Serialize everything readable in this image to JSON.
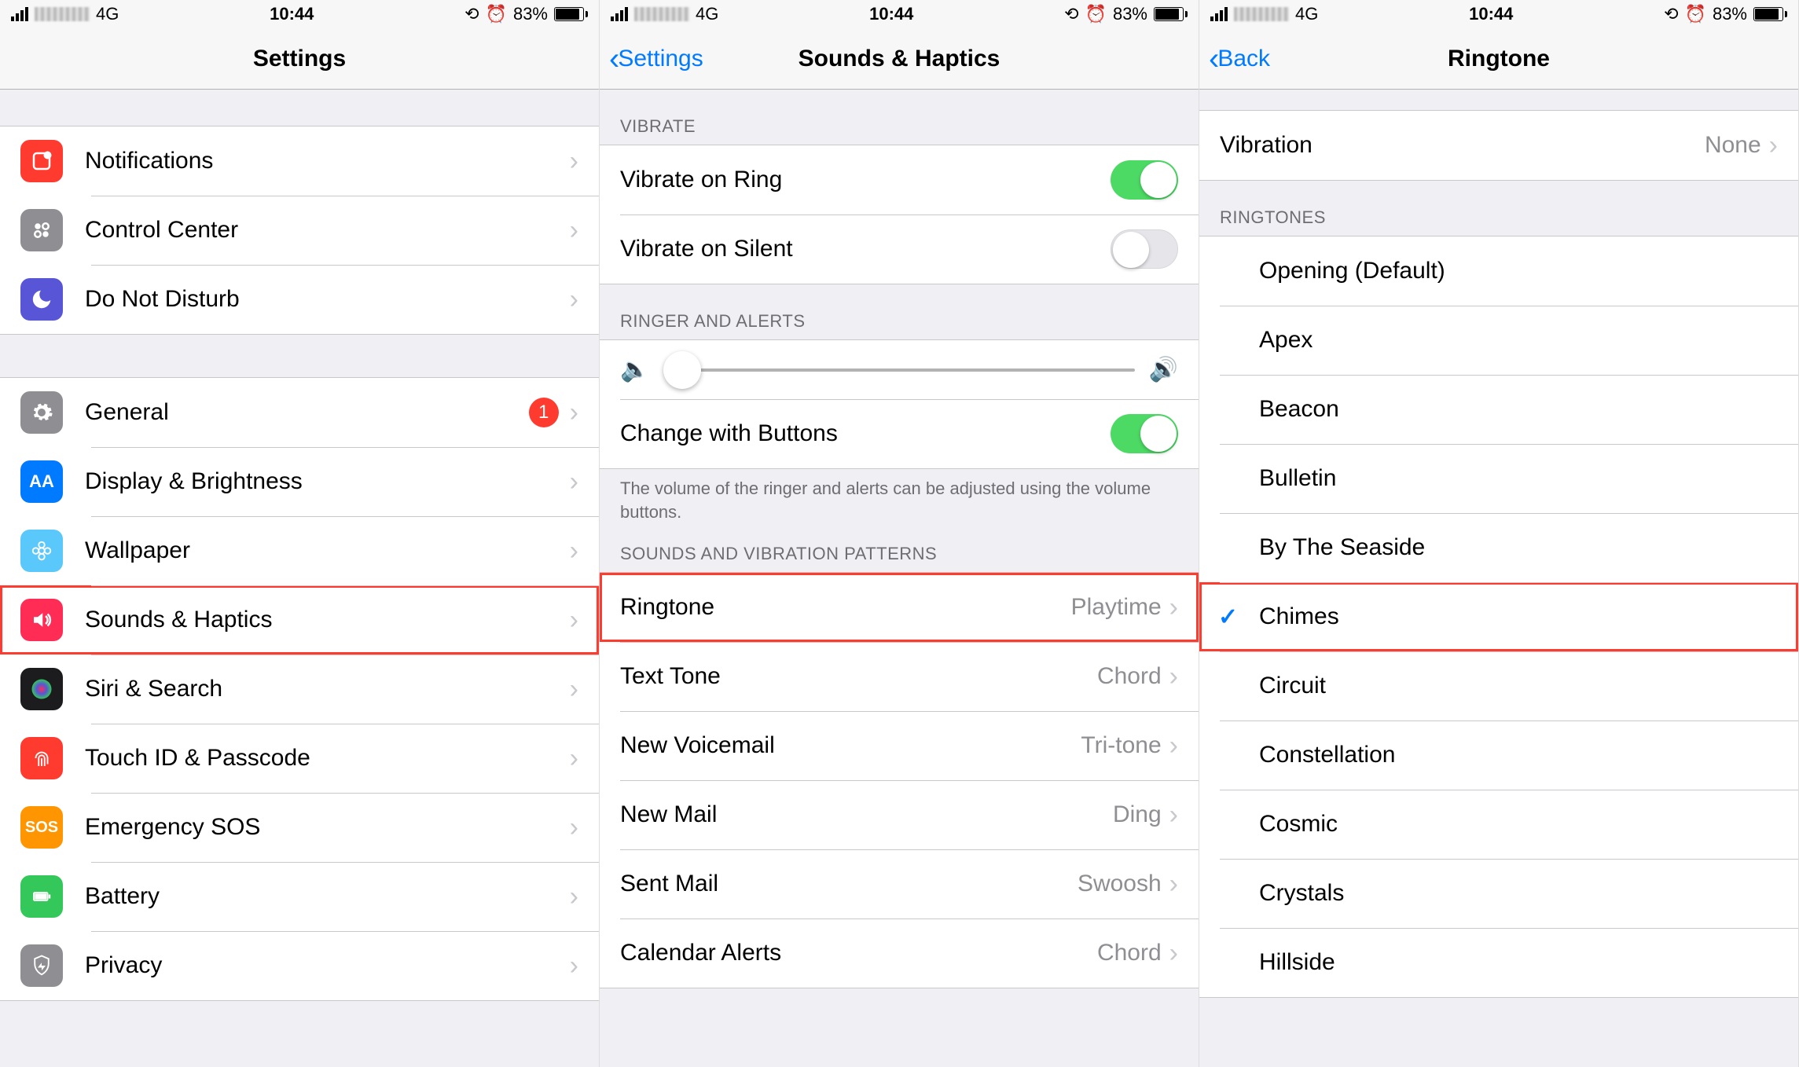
{
  "status": {
    "network": "4G",
    "time": "10:44",
    "battery_pct": "83%"
  },
  "screen1": {
    "title": "Settings",
    "group1": [
      {
        "label": "Notifications",
        "iconBg": "#ff3b30",
        "glyph": "notif"
      },
      {
        "label": "Control Center",
        "iconBg": "#8e8e93",
        "glyph": "cc"
      },
      {
        "label": "Do Not Disturb",
        "iconBg": "#5856d6",
        "glyph": "dnd"
      }
    ],
    "group2": [
      {
        "label": "General",
        "iconBg": "#8e8e93",
        "glyph": "gear",
        "badge": "1"
      },
      {
        "label": "Display & Brightness",
        "iconBg": "#007aff",
        "glyph": "display"
      },
      {
        "label": "Wallpaper",
        "iconBg": "#5ac8fa",
        "glyph": "wallpaper"
      },
      {
        "label": "Sounds & Haptics",
        "iconBg": "#ff2d55",
        "glyph": "sound",
        "highlight": true
      },
      {
        "label": "Siri & Search",
        "iconBg": "#1c1c1e",
        "glyph": "siri"
      },
      {
        "label": "Touch ID & Passcode",
        "iconBg": "#ff3b30",
        "glyph": "touchid"
      },
      {
        "label": "Emergency SOS",
        "iconBg": "#ff9500",
        "glyph": "sos"
      },
      {
        "label": "Battery",
        "iconBg": "#34c759",
        "glyph": "battery"
      },
      {
        "label": "Privacy",
        "iconBg": "#8e8e93",
        "glyph": "privacy"
      }
    ]
  },
  "screen2": {
    "back": "Settings",
    "title": "Sounds & Haptics",
    "section_vibrate": "VIBRATE",
    "vibrate_ring_label": "Vibrate on Ring",
    "vibrate_ring_on": true,
    "vibrate_silent_label": "Vibrate on Silent",
    "vibrate_silent_on": false,
    "section_ringer": "RINGER AND ALERTS",
    "change_buttons_label": "Change with Buttons",
    "change_buttons_on": true,
    "ringer_footer": "The volume of the ringer and alerts can be adjusted using the volume buttons.",
    "section_patterns": "SOUNDS AND VIBRATION PATTERNS",
    "patterns": [
      {
        "label": "Ringtone",
        "value": "Playtime",
        "highlight": true
      },
      {
        "label": "Text Tone",
        "value": "Chord"
      },
      {
        "label": "New Voicemail",
        "value": "Tri-tone"
      },
      {
        "label": "New Mail",
        "value": "Ding"
      },
      {
        "label": "Sent Mail",
        "value": "Swoosh"
      },
      {
        "label": "Calendar Alerts",
        "value": "Chord"
      }
    ]
  },
  "screen3": {
    "back": "Back",
    "title": "Ringtone",
    "vibration_label": "Vibration",
    "vibration_value": "None",
    "section_ringtones": "RINGTONES",
    "ringtones": [
      {
        "label": "Opening (Default)"
      },
      {
        "label": "Apex"
      },
      {
        "label": "Beacon"
      },
      {
        "label": "Bulletin"
      },
      {
        "label": "By The Seaside"
      },
      {
        "label": "Chimes",
        "selected": true,
        "highlight": true
      },
      {
        "label": "Circuit"
      },
      {
        "label": "Constellation"
      },
      {
        "label": "Cosmic"
      },
      {
        "label": "Crystals"
      },
      {
        "label": "Hillside"
      }
    ]
  }
}
